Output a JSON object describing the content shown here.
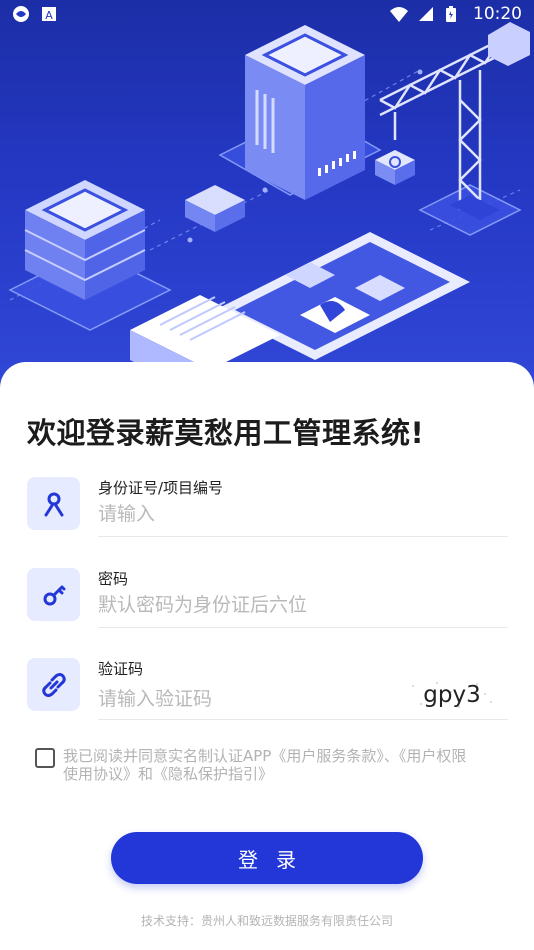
{
  "status_bar": {
    "time": "10:20",
    "left_icons": [
      "app-icon",
      "a-icon"
    ],
    "right_icons": [
      "wifi-icon",
      "signal-icon",
      "battery-icon"
    ]
  },
  "title": "欢迎登录薪莫愁用工管理系统!",
  "fields": [
    {
      "label": "身份证号/项目编号",
      "placeholder": "请输入",
      "icon": "user-icon"
    },
    {
      "label": "密码",
      "placeholder": "默认密码为身份证后六位",
      "icon": "key-icon"
    },
    {
      "label": "验证码",
      "placeholder": "请输入验证码",
      "icon": "link-icon",
      "captcha": "gpy3"
    }
  ],
  "agreement": {
    "text_line1": "我已阅读并同意实名制认证APP《用户服务条款》、《用户权限",
    "text_line2": "使用协议》和《隐私保护指引》"
  },
  "login_button": "登录",
  "footer": "技术支持：贵州人和致远数据服务有限责任公司",
  "colors": {
    "primary": "#2337d8",
    "hero_top": "#1c2ea6",
    "icon_bg": "#e7ebff",
    "placeholder": "#b9b9b9"
  }
}
